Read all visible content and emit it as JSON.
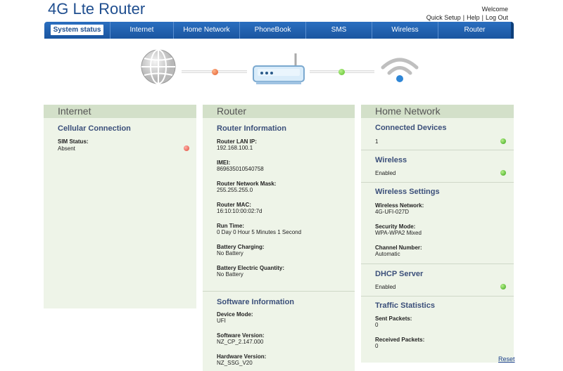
{
  "header": {
    "title": "4G Lte Router",
    "welcome": "Welcome",
    "links": {
      "quick_setup": "Quick Setup",
      "help": "Help",
      "logout": "Log Out",
      "separator": "|"
    }
  },
  "nav": {
    "items": [
      {
        "label": "System status",
        "active": true
      },
      {
        "label": "Internet"
      },
      {
        "label": "Home Network"
      },
      {
        "label": "PhoneBook"
      },
      {
        "label": "SMS"
      },
      {
        "label": "Wireless"
      },
      {
        "label": "Router"
      }
    ]
  },
  "diagram": {
    "icons": [
      "globe-icon",
      "router-icon",
      "wifi-icon"
    ],
    "status_colors": {
      "internet_link": "#e05a2a",
      "router_link": "#5cc02a"
    }
  },
  "internet_panel": {
    "heading": "Internet",
    "section": "Cellular Connection",
    "sim_label": "SIM Status:",
    "sim_value": "Absent",
    "sim_status": "red"
  },
  "router_panel": {
    "heading": "Router",
    "info_title": "Router Information",
    "fields": [
      {
        "label": "Router LAN IP:",
        "value": "192.168.100.1"
      },
      {
        "label": "IMEI:",
        "value": "869635010540758"
      },
      {
        "label": "Router Network Mask:",
        "value": "255.255.255.0"
      },
      {
        "label": "Router MAC:",
        "value": "16:10:10:00:02:7d"
      },
      {
        "label": "Run Time:",
        "value": "0 Day 0 Hour 5 Minutes 1 Second"
      },
      {
        "label": "Battery Charging:",
        "value": "No Battery"
      },
      {
        "label": "Battery Electric Quantity:",
        "value": "No Battery"
      }
    ],
    "software_title": "Software Information",
    "software_fields": [
      {
        "label": "Device Mode:",
        "value": "UFI"
      },
      {
        "label": "Software Version:",
        "value": "NZ_CP_2.147.000"
      },
      {
        "label": "Hardware Version:",
        "value": "NZ_SSG_V20"
      }
    ]
  },
  "home_panel": {
    "heading": "Home Network",
    "connected_title": "Connected Devices",
    "connected_value": "1",
    "wireless_title": "Wireless",
    "wireless_value": "Enabled",
    "wsettings_title": "Wireless Settings",
    "wsettings_fields": [
      {
        "label": "Wireless Network:",
        "value": "4G-UFI-027D"
      },
      {
        "label": "Security Mode:",
        "value": "WPA-WPA2 Mixed"
      },
      {
        "label": "Channel Number:",
        "value": "Automatic"
      }
    ],
    "dhcp_title": "DHCP Server",
    "dhcp_value": "Enabled",
    "traffic_title": "Traffic Statistics",
    "traffic_fields": [
      {
        "label": "Sent Packets:",
        "value": "0"
      },
      {
        "label": "Received Packets:",
        "value": "0"
      }
    ],
    "reset": "Reset"
  }
}
